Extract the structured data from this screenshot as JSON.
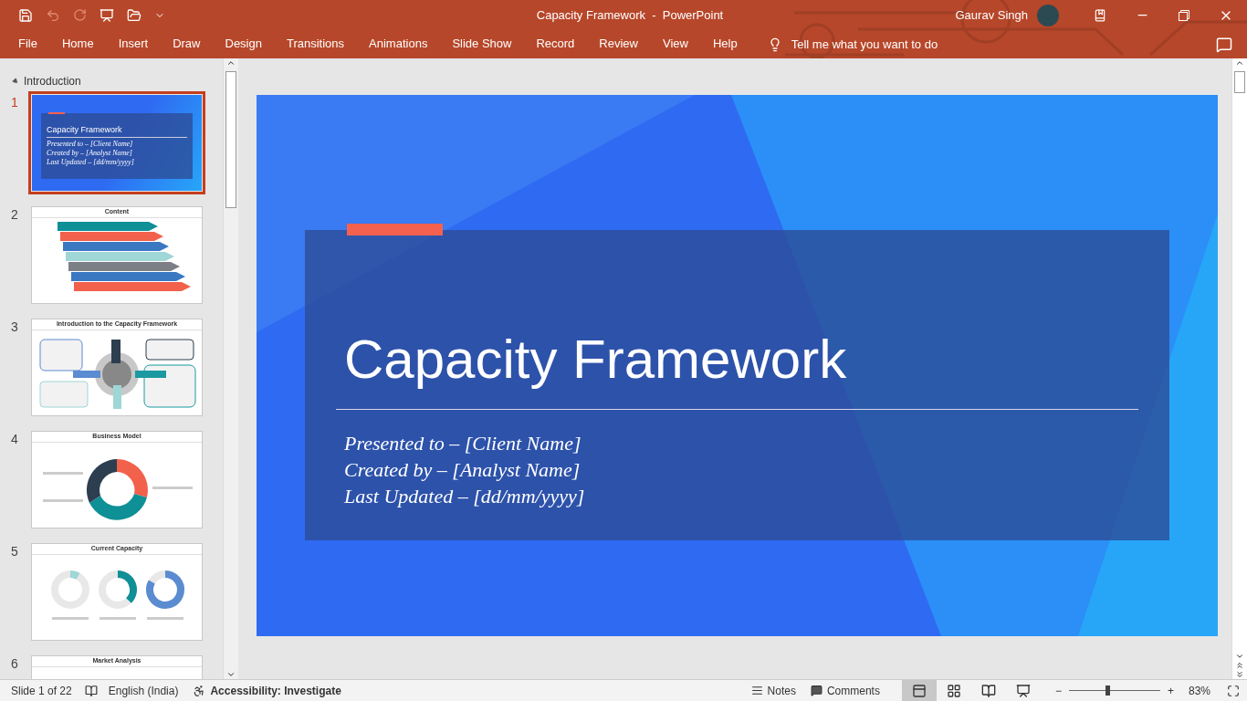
{
  "window": {
    "title": "Capacity Framework  -  PowerPoint",
    "user": "Gaurav Singh"
  },
  "ribbon_tabs": [
    {
      "label": "File",
      "selected": false
    },
    {
      "label": "Home",
      "selected": false
    },
    {
      "label": "Insert",
      "selected": false
    },
    {
      "label": "Draw",
      "selected": false
    },
    {
      "label": "Design",
      "selected": false
    },
    {
      "label": "Transitions",
      "selected": false
    },
    {
      "label": "Animations",
      "selected": false
    },
    {
      "label": "Slide Show",
      "selected": false
    },
    {
      "label": "Record",
      "selected": false
    },
    {
      "label": "Review",
      "selected": false
    },
    {
      "label": "View",
      "selected": false
    },
    {
      "label": "Help",
      "selected": false
    }
  ],
  "tell_me": "Tell me what you want to do",
  "section": {
    "name": "Introduction",
    "expanded": true
  },
  "slides": [
    {
      "number": "1",
      "selected": true,
      "kind": "title",
      "title": "Capacity Framework",
      "lines": [
        "Presented to – [Client Name]",
        "Created by – [Analyst Name]",
        "Last Updated – [dd/mm/yyyy]"
      ]
    },
    {
      "number": "2",
      "selected": false,
      "kind": "agenda",
      "title": "Content"
    },
    {
      "number": "3",
      "selected": false,
      "kind": "diagram",
      "title": "Introduction to the Capacity Framework"
    },
    {
      "number": "4",
      "selected": false,
      "kind": "cycle",
      "title": "Business Model"
    },
    {
      "number": "5",
      "selected": false,
      "kind": "donuts",
      "title": "Current Capacity"
    },
    {
      "number": "6",
      "selected": false,
      "kind": "partial",
      "title": "Market Analysis"
    }
  ],
  "slide": {
    "title": "Capacity Framework",
    "lines": [
      "Presented to – [Client Name]",
      "Created by – [Analyst Name]",
      "Last Updated – [dd/mm/yyyy]"
    ]
  },
  "status_bar": {
    "slide_count": "Slide 1 of 22",
    "language": "English (India)",
    "accessibility": "Accessibility: Investigate",
    "notes": "Notes",
    "comments": "Comments",
    "views": [
      {
        "kind": "normal",
        "selected": true
      },
      {
        "kind": "sorter",
        "selected": false
      },
      {
        "kind": "reading",
        "selected": false
      },
      {
        "kind": "show",
        "selected": false
      }
    ],
    "zoom": {
      "minus": "−",
      "plus": "+",
      "level": 0.42,
      "reading": "83%"
    }
  }
}
